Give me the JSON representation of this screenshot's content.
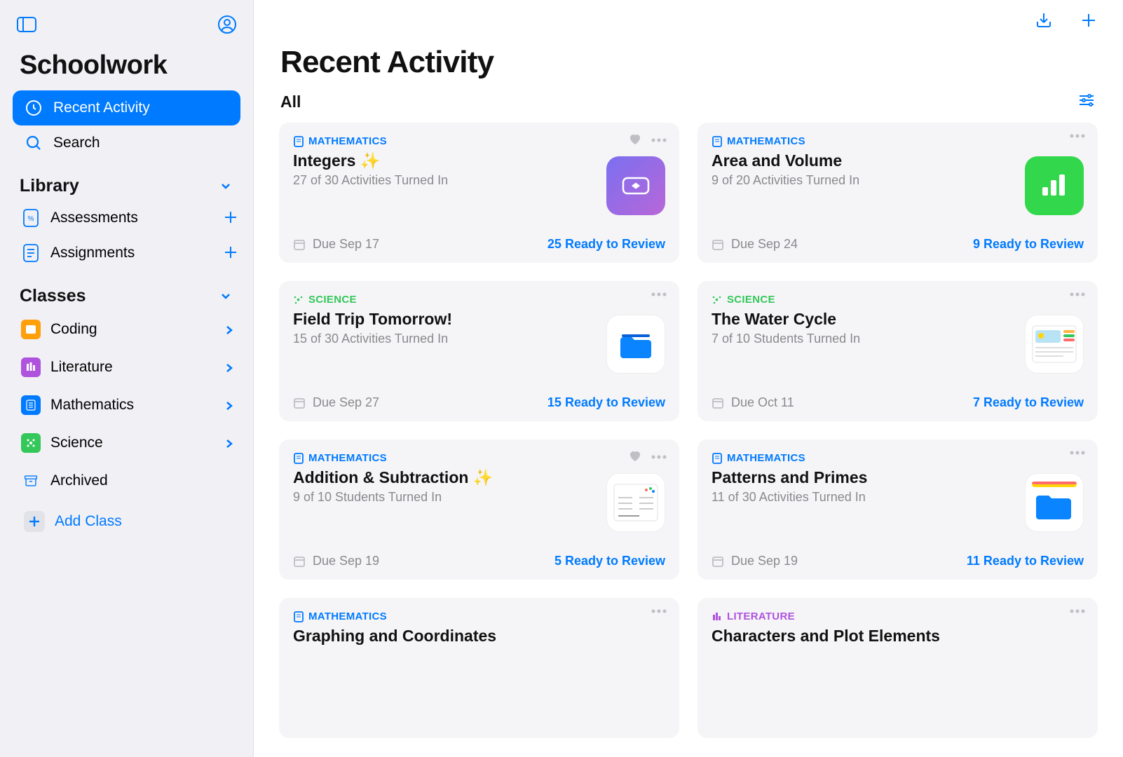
{
  "app_title": "Schoolwork",
  "sidebar": {
    "recent_activity": "Recent Activity",
    "search": "Search",
    "library_header": "Library",
    "assessments": "Assessments",
    "assignments": "Assignments",
    "classes_header": "Classes",
    "coding": "Coding",
    "literature": "Literature",
    "mathematics": "Mathematics",
    "science": "Science",
    "archived": "Archived",
    "add_class": "Add Class"
  },
  "main": {
    "page_title": "Recent Activity",
    "filter": "All"
  },
  "subjects": {
    "mathematics": "MATHEMATICS",
    "science": "SCIENCE",
    "literature": "LITERATURE"
  },
  "cards": [
    {
      "title": "Integers ✨",
      "sub": "27 of 30 Activities Turned In",
      "due": "Due Sep 17",
      "ready": "25 Ready to Review"
    },
    {
      "title": "Area and Volume",
      "sub": "9 of 20 Activities Turned In",
      "due": "Due Sep 24",
      "ready": "9 Ready to Review"
    },
    {
      "title": "Field Trip Tomorrow!",
      "sub": "15 of 30 Activities Turned In",
      "due": "Due Sep 27",
      "ready": "15 Ready to Review"
    },
    {
      "title": "The Water Cycle",
      "sub": "7 of 10 Students Turned In",
      "due": "Due Oct 11",
      "ready": "7 Ready to Review"
    },
    {
      "title": "Addition & Subtraction ✨",
      "sub": "9 of 10 Students Turned In",
      "due": "Due Sep 19",
      "ready": "5 Ready to Review"
    },
    {
      "title": "Patterns and Primes",
      "sub": "11 of 30 Activities Turned In",
      "due": "Due Sep 19",
      "ready": "11 Ready to Review"
    },
    {
      "title": "Graphing and Coordinates",
      "sub": "",
      "due": "",
      "ready": ""
    },
    {
      "title": "Characters and Plot Elements",
      "sub": "",
      "due": "",
      "ready": ""
    }
  ]
}
